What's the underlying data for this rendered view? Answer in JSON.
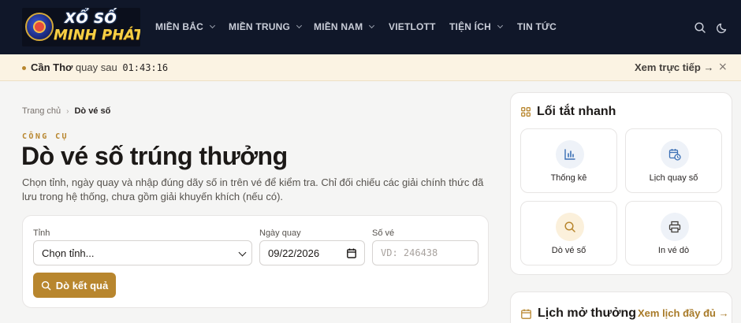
{
  "brand": {
    "line1": "XỔ SỐ",
    "line2": "MINH PHÁT"
  },
  "nav": [
    {
      "label": "MIỀN BẮC",
      "has_dropdown": true
    },
    {
      "label": "MIỀN TRUNG",
      "has_dropdown": true
    },
    {
      "label": "MIỀN NAM",
      "has_dropdown": true
    },
    {
      "label": "VIETLOTT",
      "has_dropdown": false
    },
    {
      "label": "TIỆN ÍCH",
      "has_dropdown": true
    },
    {
      "label": "TIN TỨC",
      "has_dropdown": false
    }
  ],
  "header_icons": [
    "search-icon",
    "moon-icon"
  ],
  "announcement": {
    "province": "Cần Thơ",
    "text": "quay sau",
    "countdown": "01:43:16",
    "link": "Xem trực tiếp →",
    "close": "×"
  },
  "breadcrumb": {
    "home": "Trang chủ",
    "separator": "›",
    "current": "Dò vé số"
  },
  "page": {
    "eyebrow": "CÔNG CỤ",
    "title": "Dò vé số trúng thưởng",
    "description": "Chọn tỉnh, ngày quay và nhập đúng dãy số in trên vé để kiểm tra. Chỉ đối chiếu các giải chính thức đã lưu trong hệ thống, chưa gồm giải khuyến khích (nếu có)."
  },
  "form": {
    "province_label": "Tỉnh",
    "province_value": "Chọn tỉnh...",
    "date_label": "Ngày quay",
    "date_value": "09/22/2026",
    "ticket_label": "Số vé",
    "ticket_placeholder": "VD: 246438",
    "submit_label": "Dò kết quả"
  },
  "shortcuts": {
    "title": "Lối tắt nhanh",
    "items": [
      {
        "label": "Thống kê",
        "icon": "bar-chart-icon"
      },
      {
        "label": "Lịch quay số",
        "icon": "calendar-clock-icon"
      },
      {
        "label": "Dò vé số",
        "icon": "search-icon"
      },
      {
        "label": "In vé dò",
        "icon": "printer-icon"
      }
    ]
  },
  "schedule": {
    "title": "Lịch mở thưởng",
    "link": "Xem lịch đầy đủ →"
  },
  "colors": {
    "header_bg": "#101729",
    "accent": "#b8862e",
    "announce_bg": "#fbf3e3",
    "page_bg": "#f5f5f4"
  }
}
